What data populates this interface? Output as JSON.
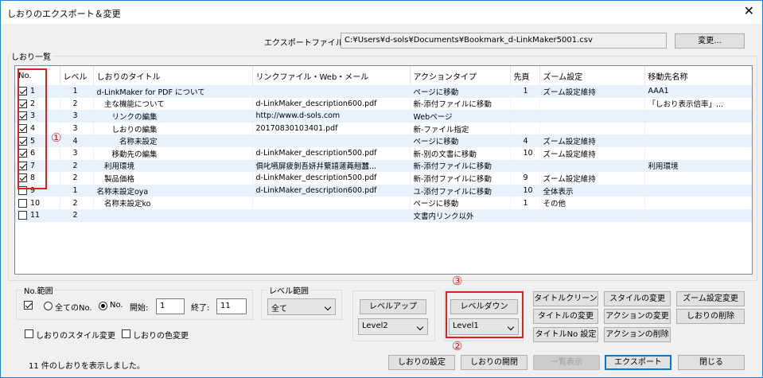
{
  "window": {
    "title": "しおりのエクスポート＆変更",
    "close_glyph": "✕"
  },
  "export": {
    "label": "エクスポートファイル:",
    "value": "C:¥Users¥d-sols¥Documents¥Bookmark_d-LinkMaker5001.csv",
    "change_button": "変更..."
  },
  "list": {
    "group_label": "しおり一覧",
    "columns": [
      "No.",
      "レベル",
      "しおりのタイトル",
      "リンクファイル・Web・メール",
      "アクションタイプ",
      "先頁",
      "ズーム設定",
      "移動先名称"
    ],
    "rows": [
      {
        "checked": true,
        "no": "1",
        "level": "1",
        "title": "d-LinkMaker for PDF について",
        "link": "",
        "action": "ページに移動",
        "page": "1",
        "zoom": "ズーム設定維持",
        "dest": "AAA1"
      },
      {
        "checked": true,
        "no": "2",
        "level": "2",
        "title": "　主な機能について",
        "link": "d-LinkMaker_description600.pdf",
        "action": "新-添付ファイルに移動",
        "page": "",
        "zoom": "",
        "dest": "「しおり表示倍率」..."
      },
      {
        "checked": true,
        "no": "3",
        "level": "3",
        "title": "　　リンクの編集",
        "link": "http://www.d-sols.com",
        "action": "Webページ",
        "page": "",
        "zoom": "",
        "dest": ""
      },
      {
        "checked": true,
        "no": "4",
        "level": "3",
        "title": "　　しおりの編集",
        "link": "20170830103401.pdf",
        "action": "新-ファイル指定",
        "page": "",
        "zoom": "",
        "dest": ""
      },
      {
        "checked": true,
        "no": "5",
        "level": "4",
        "title": "　　　名称未設定",
        "link": "",
        "action": "ページに移動",
        "page": "4",
        "zoom": "ズーム設定維持",
        "dest": ""
      },
      {
        "checked": true,
        "no": "6",
        "level": "3",
        "title": "　　移動先の編集",
        "link": "d-LinkMaker_description500.pdf",
        "action": "新-別の文書に移動",
        "page": "10",
        "zoom": "ズーム設定維持",
        "dest": ""
      },
      {
        "checked": true,
        "no": "7",
        "level": "2",
        "title": "　利用環境",
        "link": "俱叱嚥屏疲剝吾妍幷蘩譆蘧蕘翹蠶...",
        "action": "新-添付ファイルに移動",
        "page": "",
        "zoom": "",
        "dest": "利用環境"
      },
      {
        "checked": true,
        "no": "8",
        "level": "2",
        "title": "　製品価格",
        "link": "d-LinkMaker_description500.pdf",
        "action": "新-添付ファイルに移動",
        "page": "9",
        "zoom": "ズーム設定維持",
        "dest": ""
      },
      {
        "checked": false,
        "no": "9",
        "level": "1",
        "title": "名称未設定oya",
        "link": "d-LinkMaker_description600.pdf",
        "action": "ユ-添付ファイルに移動",
        "page": "10",
        "zoom": "全体表示",
        "dest": ""
      },
      {
        "checked": false,
        "no": "10",
        "level": "2",
        "title": "　名称未設定ko",
        "link": "",
        "action": "ページに移動",
        "page": "1",
        "zoom": "その他",
        "dest": ""
      },
      {
        "checked": false,
        "no": "11",
        "level": "2",
        "title": "",
        "link": "",
        "action": "文書内リンク以外",
        "page": "",
        "zoom": "",
        "dest": ""
      }
    ]
  },
  "no_range": {
    "label": "No.範囲",
    "all_label": "全てのNo.",
    "no_label": "No.",
    "start_label": "開始:",
    "start_value": "1",
    "end_label": "終了:",
    "end_value": "11"
  },
  "level_range": {
    "label": "レベル範囲",
    "selected": "全て"
  },
  "options": {
    "style_change": "しおりのスタイル変更",
    "color_change": "しおりの色変更"
  },
  "level_ops": {
    "level_up": "レベルアップ",
    "level_up_select": "Level2",
    "level_down": "レベルダウン",
    "level_down_select": "Level1"
  },
  "ops": {
    "title_clean": "タイトルクリーン",
    "style_change": "スタイルの変更",
    "zoom_change": "ズーム設定変更",
    "title_change": "タイトルの変更",
    "action_change": "アクションの変更",
    "delete": "しおりの削除",
    "title_no": "タイトルNo 設定",
    "action_delete": "アクションの削除"
  },
  "markers": {
    "m1": "①",
    "m2": "②",
    "m3": "③"
  },
  "status": "11 件のしおりを表示しました。",
  "bottom": {
    "settings": "しおりの設定",
    "open_close": "しおりの開閉",
    "list_view": "一覧表示",
    "export": "エクスポート",
    "close": "閉じる"
  }
}
